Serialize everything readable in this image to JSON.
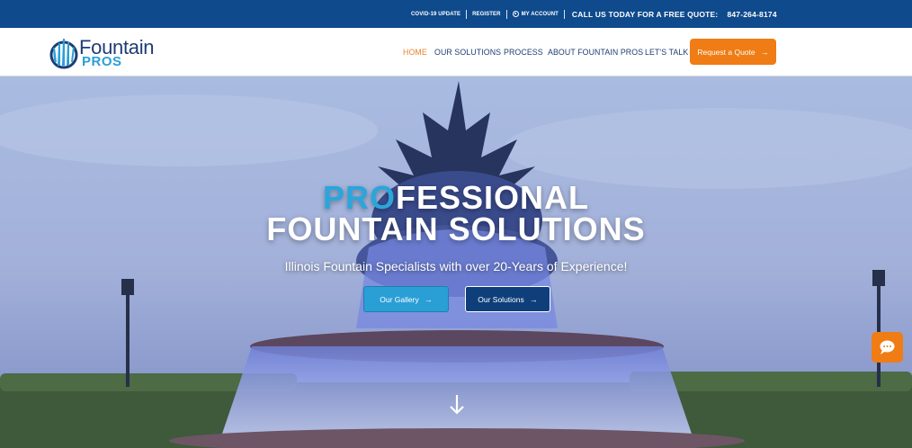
{
  "topbar": {
    "covid": "COVID-19 UPDATE",
    "register": "REGISTER",
    "account": "MY ACCOUNT",
    "call_label": "CALL US TODAY FOR A FREE QUOTE:",
    "phone": "847-264-8174",
    "background": "#0e4a8c"
  },
  "logo": {
    "line1": "Fountain",
    "line2": "PROS",
    "icon": "fountain-splash-icon"
  },
  "nav": {
    "items": [
      "HOME",
      "OUR SOLUTIONS",
      "PROCESS",
      "ABOUT FOUNTAIN PROS",
      "LET'S TALK"
    ],
    "active_item": "HOME",
    "cta": "Request a Quote",
    "cta_color": "#ef7c14"
  },
  "hero": {
    "title_highlight": "PRO",
    "title_rest": "FESSIONAL",
    "title_line2": "FOUNTAIN SOLUTIONS",
    "subtitle": "Illinois Fountain Specialists with over 20-Years of Experience!",
    "btn_gallery": "Our Gallery",
    "btn_solutions": "Our Solutions",
    "scroll_icon": "arrow-down-icon"
  },
  "chat": {
    "icon": "chat-bubble-icon",
    "color": "#ef7c14"
  }
}
